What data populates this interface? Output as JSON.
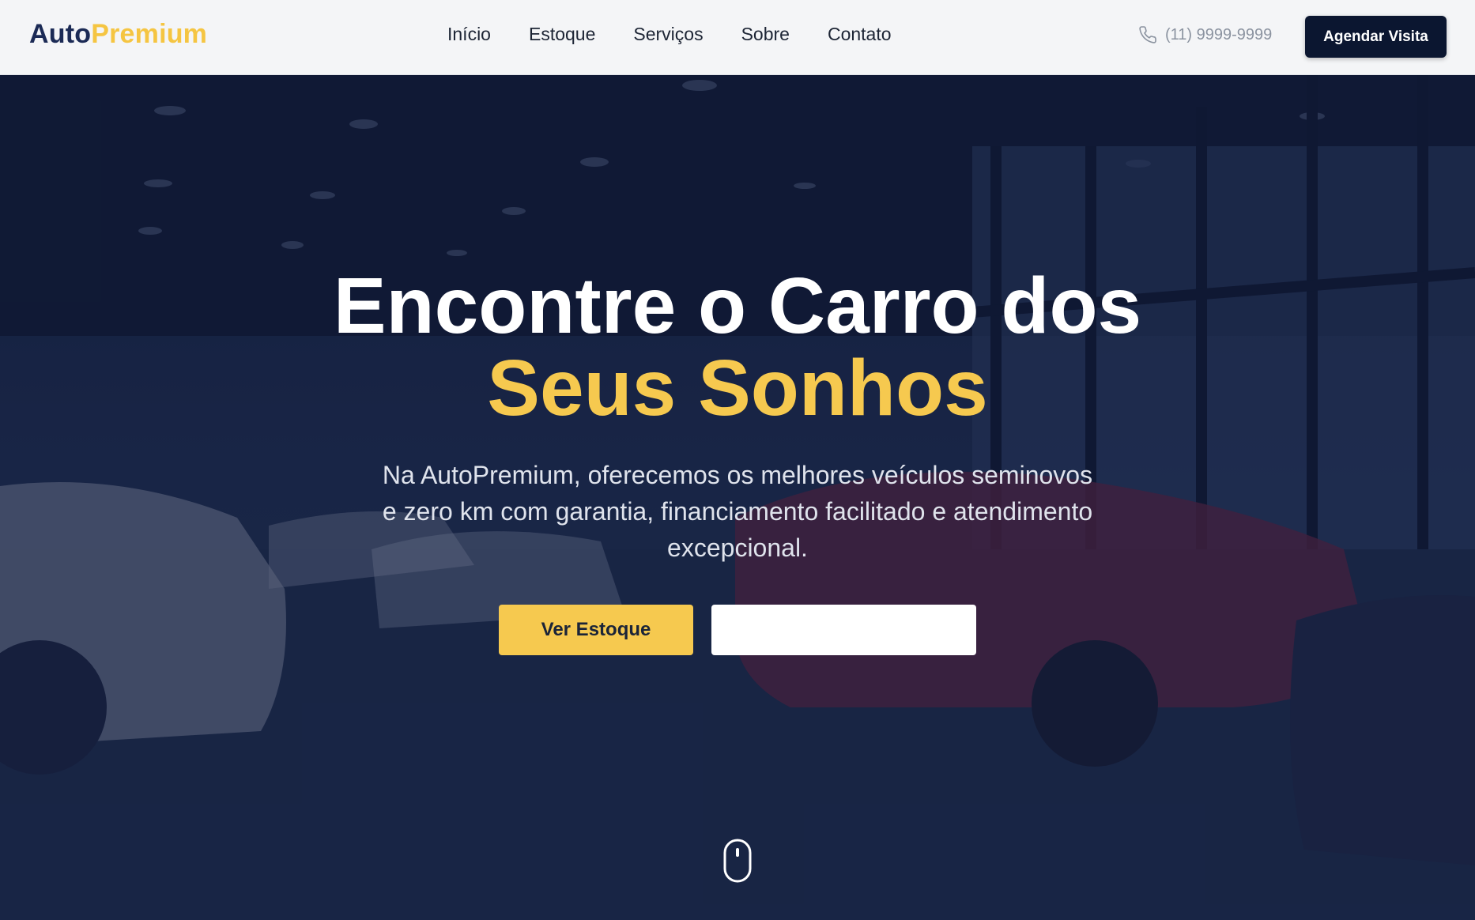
{
  "header": {
    "logo": {
      "part1": "Auto",
      "part2": "Premium"
    },
    "nav": [
      "Início",
      "Estoque",
      "Serviços",
      "Sobre",
      "Contato"
    ],
    "phone": "(11) 9999-9999",
    "cta_label": "Agendar Visita"
  },
  "hero": {
    "title_line1": "Encontre o Carro dos",
    "title_line2": "Seus Sonhos",
    "subtitle": "Na AutoPremium, oferecemos os melhores veículos seminovos e zero km com garantia, financiamento facilitado e atendimento excepcional.",
    "primary_button": "Ver Estoque",
    "secondary_button": ""
  },
  "icons": {
    "phone": "phone-icon",
    "scroll": "mouse-scroll-icon"
  },
  "colors": {
    "brand_dark": "#0b1630",
    "logo_blue": "#1b2a55",
    "accent": "#f6c94f",
    "hero_overlay": "#15213f"
  }
}
